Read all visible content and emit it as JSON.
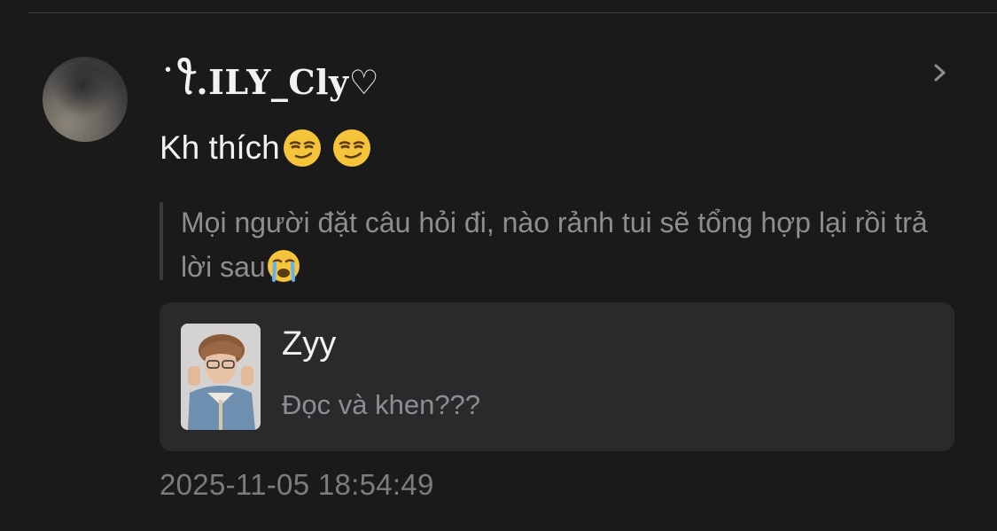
{
  "post": {
    "username": "˙ꪻ.ILY_Cly♡",
    "comment_text": "Kh thích",
    "comment_emojis": [
      "smirk-emoji",
      "smirk-emoji"
    ],
    "quoted_text": "Mọi người đặt câu hỏi đi, nào rảnh tui sẽ tổng hợp lại rồi trả lời sau",
    "quoted_emoji": "crying-emoji",
    "card": {
      "title": "Zyy",
      "subtitle": "Đọc và khen???"
    },
    "timestamp": "2025-11-05 18:54:49"
  },
  "colors": {
    "background": "#1a1a1b",
    "card_background": "#2a2a2c",
    "primary_text": "#f2f2f2",
    "secondary_text": "#8e8e92",
    "divider": "#3a3a3c",
    "emoji_yellow": "#f6c43a"
  }
}
